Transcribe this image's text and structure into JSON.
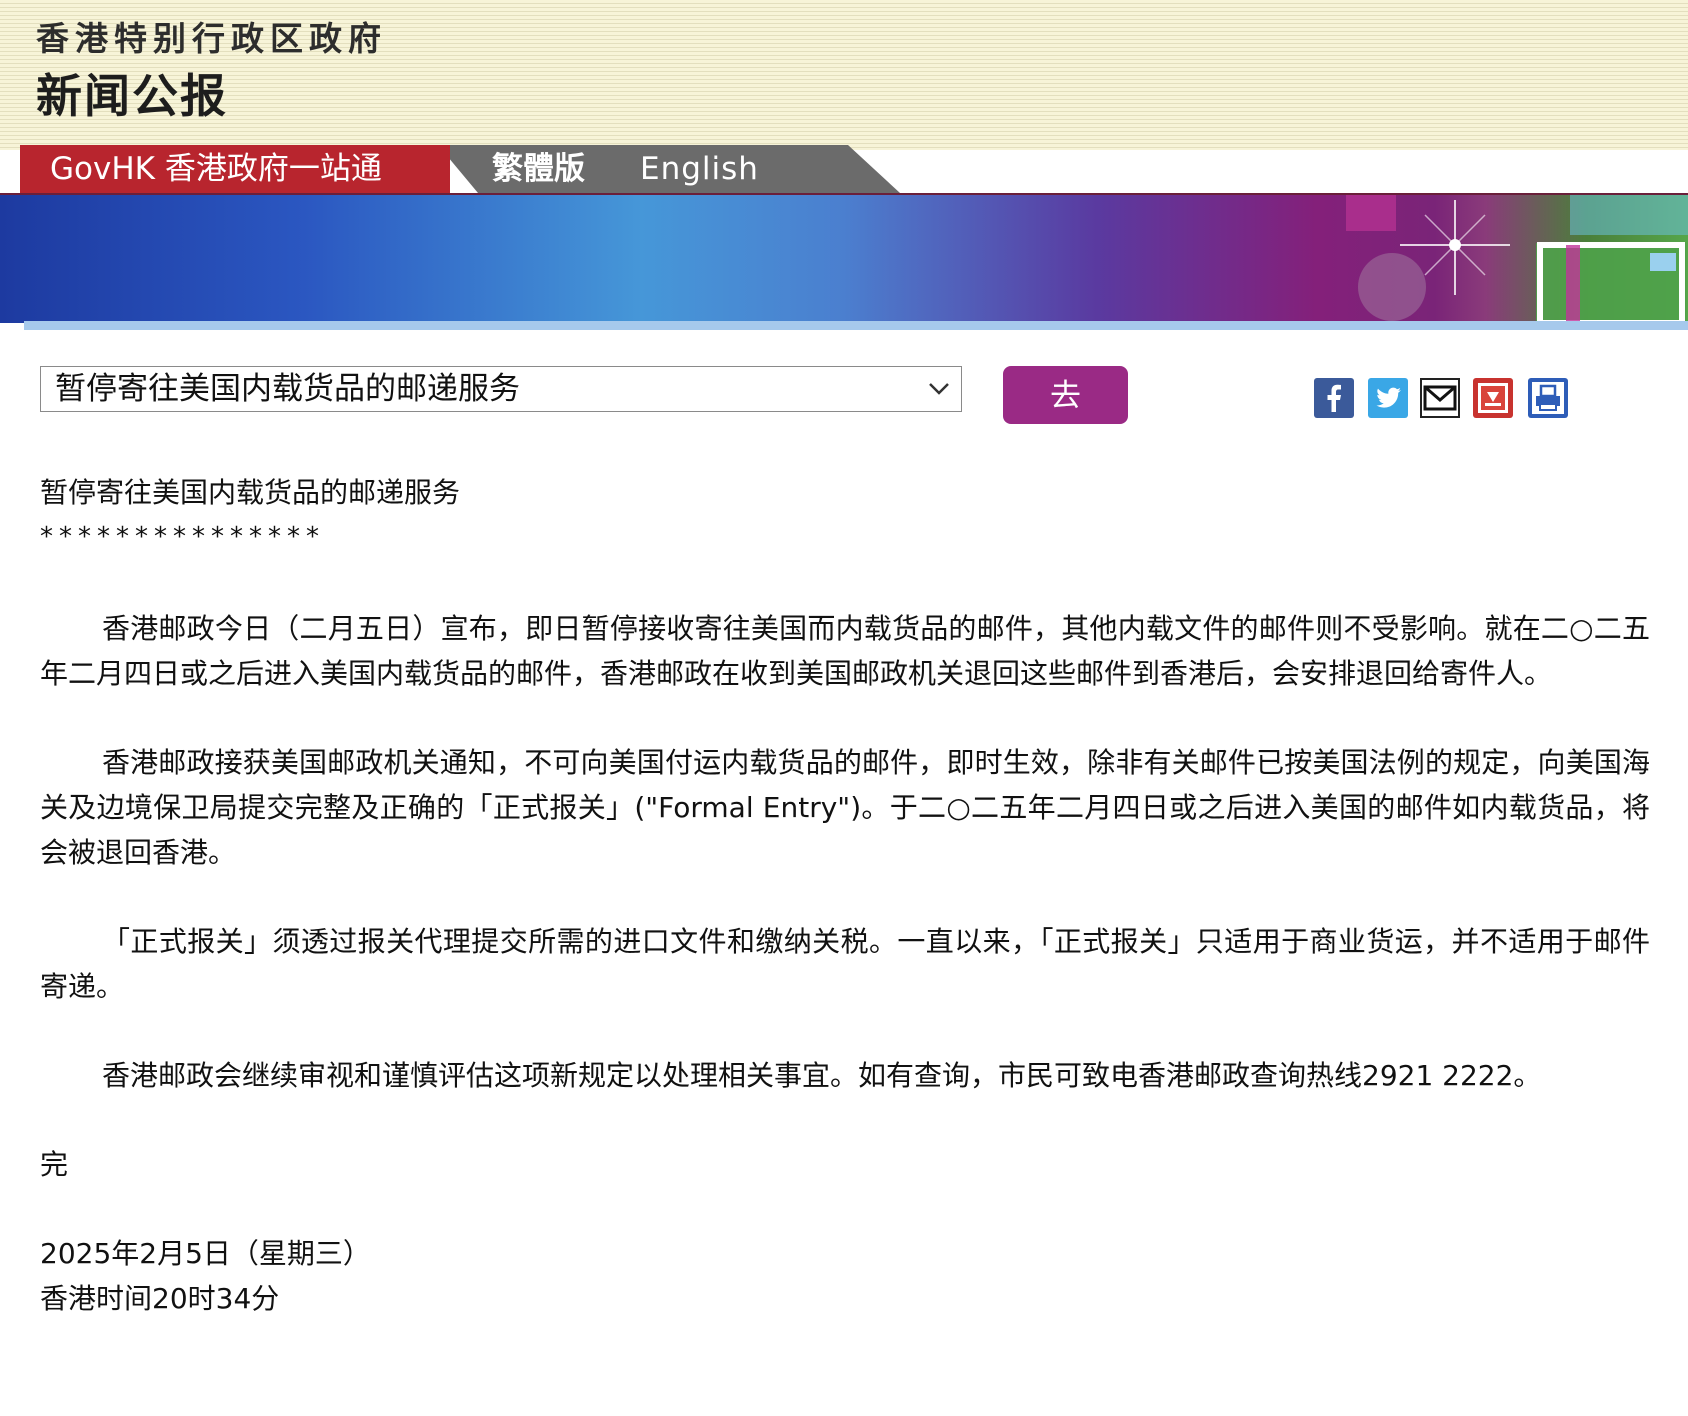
{
  "header": {
    "government": "香港特别行政区政府",
    "title": "新闻公报"
  },
  "nav": {
    "govhk": "GovHK 香港政府一站通",
    "traditional": "繁體版",
    "english": "English"
  },
  "toolbar": {
    "selected_story": "暂停寄往美国内载货品的邮递服务",
    "go_label": "去",
    "share_icons": [
      "facebook-icon",
      "twitter-icon",
      "email-icon",
      "download-icon",
      "print-icon"
    ]
  },
  "article": {
    "headline": "暂停寄往美国内载货品的邮递服务",
    "separator": "***************",
    "paragraphs": [
      "香港邮政今日（二月五日）宣布，即日暂停接收寄往美国而内载货品的邮件，其他内载文件的邮件则不受影响。就在二○二五年二月四日或之后进入美国内载货品的邮件，香港邮政在收到美国邮政机关退回这些邮件到香港后，会安排退回给寄件人。",
      "香港邮政接获美国邮政机关通知，不可向美国付运内载货品的邮件，即时生效，除非有关邮件已按美国法例的规定，向美国海关及边境保卫局提交完整及正确的「正式报关」(\"Formal Entry\")。于二○二五年二月四日或之后进入美国的邮件如内载货品，将会被退回香港。",
      "「正式报关」须透过报关代理提交所需的进口文件和缴纳关税。一直以来，「正式报关」只适用于商业货运，并不适用于邮件寄递。",
      "香港邮政会继续审视和谨慎评估这项新规定以处理相关事宜。如有查询，市民可致电香港邮政查询热线2921 2222。"
    ],
    "end_mark": "完",
    "date": "2025年2月5日（星期三）",
    "time": "香港时间20时34分"
  },
  "colors": {
    "govhk_red": "#b8252e",
    "nav_gray": "#6b6b6b",
    "go_purple": "#9a2a85"
  }
}
